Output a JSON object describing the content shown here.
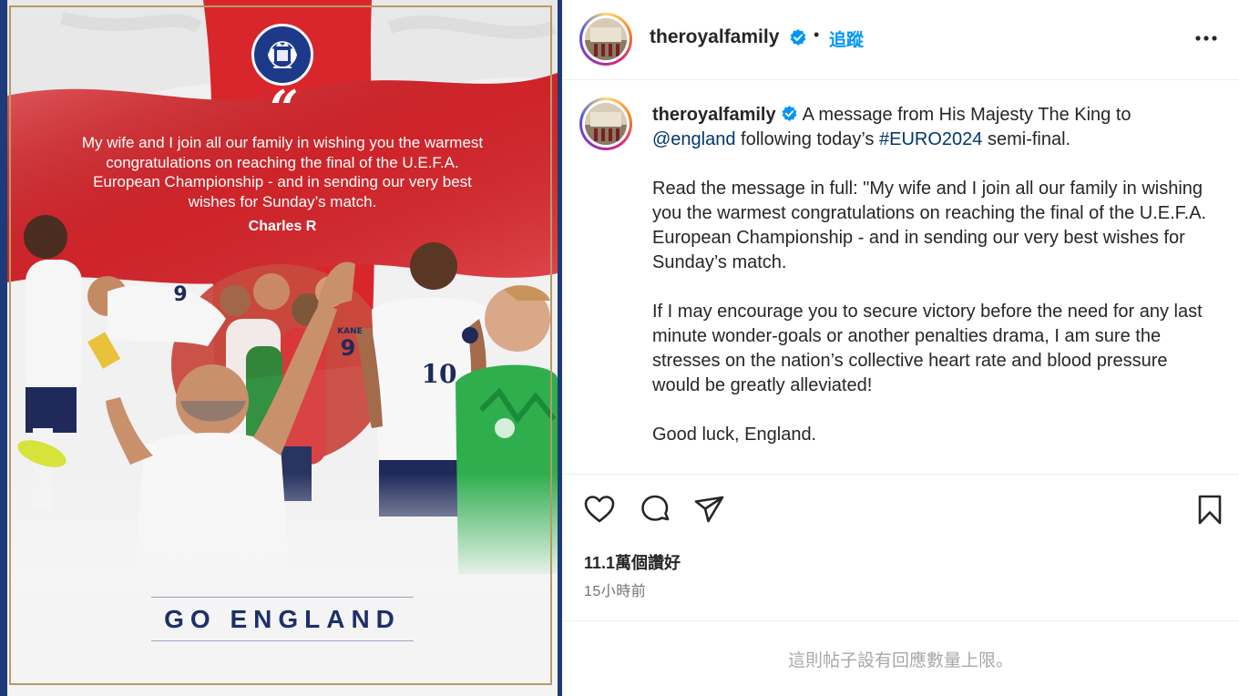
{
  "post_image": {
    "quote_mark": "“",
    "quote_text": "My wife and I join all our family in wishing you the warmest congratulations on reaching the final of the U.E.F.A. European Championship - and in sending our very best wishes for Sunday’s match.",
    "signature": "Charles R",
    "banner": "GO ENGLAND",
    "crest_icon": "royal-crest-icon",
    "shirt_number_left": "9",
    "shirt_number_center": "9",
    "shirt_number_right": "10",
    "shirt_name_center": "KANE"
  },
  "header": {
    "username": "theroyalfamily",
    "verified_icon": "verified-badge-icon",
    "separator": "•",
    "follow_label": "追蹤",
    "more_icon": "more-options-icon"
  },
  "caption": {
    "username": "theroyalfamily",
    "intro_text": "A message from His Majesty The King to",
    "mention": "@england",
    "intro_after_mention": "following today’s",
    "hashtag": "#EURO2024",
    "intro_end": "semi-final.",
    "paragraph_2": "Read the message in full: \"My wife and I join all our family in wishing you the warmest congratulations on reaching the final of the U.E.F.A. European Championship - and in sending our very best wishes for Sunday’s match.",
    "paragraph_3": "If I may encourage you to secure victory before the need for any last minute wonder-goals or another penalties drama, I am sure the stresses on the nation’s collective heart rate and blood pressure would be greatly alleviated!",
    "paragraph_4": "Good luck, England."
  },
  "actions": {
    "like_icon": "heart-icon",
    "comment_icon": "comment-icon",
    "share_icon": "share-icon",
    "save_icon": "bookmark-icon",
    "likes_count": "11.1萬個讚好",
    "timestamp": "15小時前"
  },
  "footer": {
    "limit_note": "這則帖子設有回應數量上限。"
  },
  "colors": {
    "link_blue": "#0095f6",
    "mention_blue": "#00376b",
    "royal_navy": "#1d3a8a",
    "st_george_red": "#d9262c",
    "gold": "#b89a62"
  }
}
